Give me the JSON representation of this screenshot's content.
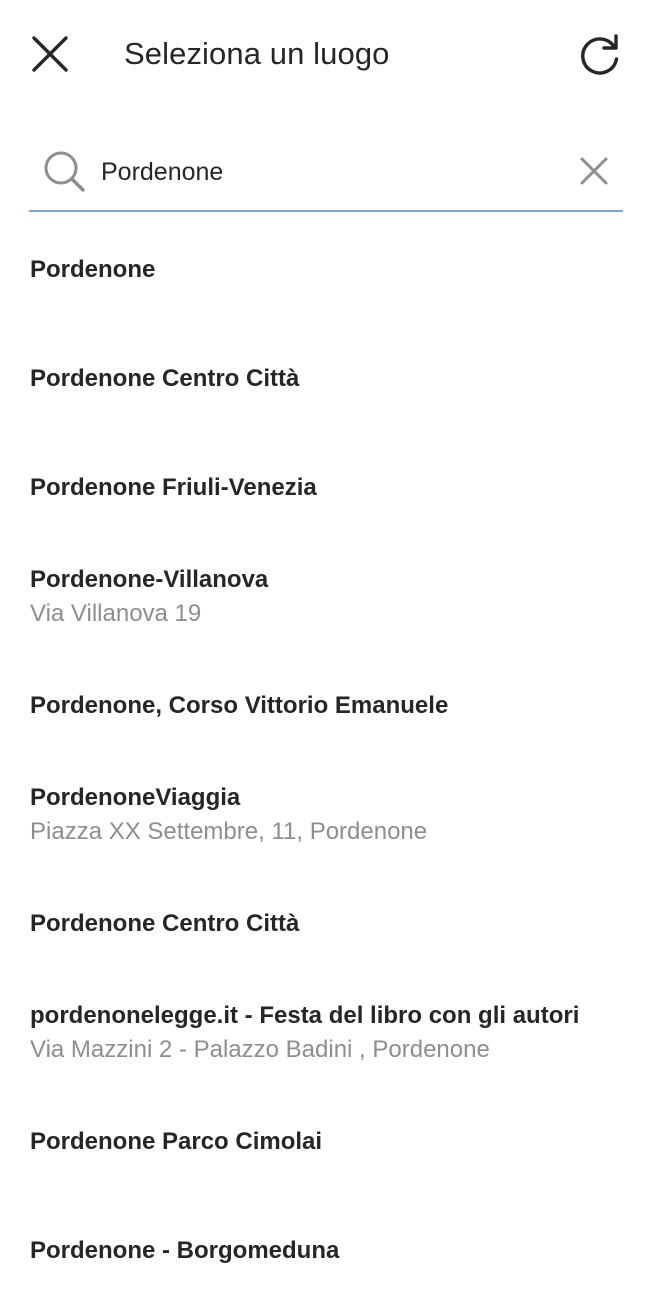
{
  "header": {
    "title": "Seleziona un luogo",
    "close_icon": "close-icon",
    "refresh_icon": "refresh-icon"
  },
  "search": {
    "value": "Pordenone",
    "placeholder": "",
    "search_icon": "search-icon",
    "clear_icon": "clear-icon"
  },
  "colors": {
    "text": "#262626",
    "subtext": "#8e8e8e",
    "accent_line": "#7fa7c0",
    "icon": "#262626"
  },
  "results": [
    {
      "name": "Pordenone",
      "sub": ""
    },
    {
      "name": "Pordenone Centro Città",
      "sub": ""
    },
    {
      "name": "Pordenone Friuli-Venezia",
      "sub": ""
    },
    {
      "name": "Pordenone-Villanova",
      "sub": "Via Villanova 19"
    },
    {
      "name": "Pordenone, Corso Vittorio Emanuele",
      "sub": ""
    },
    {
      "name": "PordenoneViaggia",
      "sub": "Piazza XX Settembre, 11, Pordenone"
    },
    {
      "name": "Pordenone Centro Città",
      "sub": ""
    },
    {
      "name": "pordenonelegge.it - Festa del libro con gli autori",
      "sub": "Via Mazzini 2 - Palazzo Badini , Pordenone"
    },
    {
      "name": "Pordenone Parco Cimolai",
      "sub": ""
    },
    {
      "name": "Pordenone - Borgomeduna",
      "sub": ""
    }
  ]
}
